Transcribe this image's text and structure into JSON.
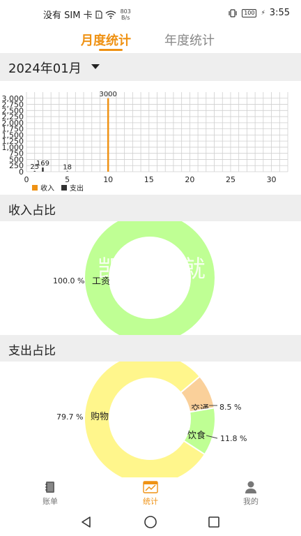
{
  "status_bar": {
    "carrier": "没有 SIM 卡",
    "net_speed_value": "803",
    "net_speed_unit": "B/s",
    "battery": "100",
    "time": "3:55"
  },
  "tabs": [
    {
      "label": "月度统计",
      "active": true
    },
    {
      "label": "年度统计",
      "active": false
    }
  ],
  "month_selector": {
    "label": "2024年01月"
  },
  "chart_data": [
    {
      "type": "bar",
      "x_ticks": [
        "0",
        "5",
        "10",
        "15",
        "20",
        "25",
        "30"
      ],
      "y_ticks": [
        "0",
        "250",
        "500",
        "750",
        "1,000",
        "1,250",
        "1,500",
        "1,750",
        "2,000",
        "2,250",
        "2,500",
        "2,750",
        "3,000"
      ],
      "ylim": [
        0,
        3250
      ],
      "xlim": [
        0,
        32
      ],
      "grid": true,
      "legend_position": "bottom-left",
      "series": [
        {
          "name": "收入",
          "color": "#ef9214",
          "points": [
            {
              "x": 10,
              "y": 3000,
              "label": "3000"
            }
          ]
        },
        {
          "name": "支出",
          "color": "#333333",
          "points": [
            {
              "x": 1,
              "y": 25,
              "label": "25"
            },
            {
              "x": 2,
              "y": 169,
              "label": "169"
            },
            {
              "x": 5,
              "y": 18,
              "label": "18"
            }
          ]
        }
      ]
    },
    {
      "type": "pie",
      "title": "收入占比",
      "slices": [
        {
          "label": "工资",
          "value": 100.0,
          "percent_label": "100.0 %",
          "color": "#bfff94"
        }
      ]
    },
    {
      "type": "pie",
      "title": "支出占比",
      "slices": [
        {
          "label": "购物",
          "value": 79.7,
          "percent_label": "79.7 %",
          "color": "#fff68c"
        },
        {
          "label": "交通",
          "value": 8.5,
          "percent_label": "8.5 %",
          "color": "#fad09a"
        },
        {
          "label": "饮食",
          "value": 11.8,
          "percent_label": "11.8 %",
          "color": "#bfff94"
        }
      ]
    }
  ],
  "sections": {
    "income_title": "收入占比",
    "expense_title": "支出占比"
  },
  "watermark": "凯时 立就",
  "bottom_nav": [
    {
      "label": "账单",
      "icon": "notebook-icon"
    },
    {
      "label": "统计",
      "icon": "chart-icon",
      "active": true
    },
    {
      "label": "我的",
      "icon": "user-icon"
    }
  ],
  "colors": {
    "accent": "#ef9214",
    "header_bg": "#eeeeee"
  }
}
